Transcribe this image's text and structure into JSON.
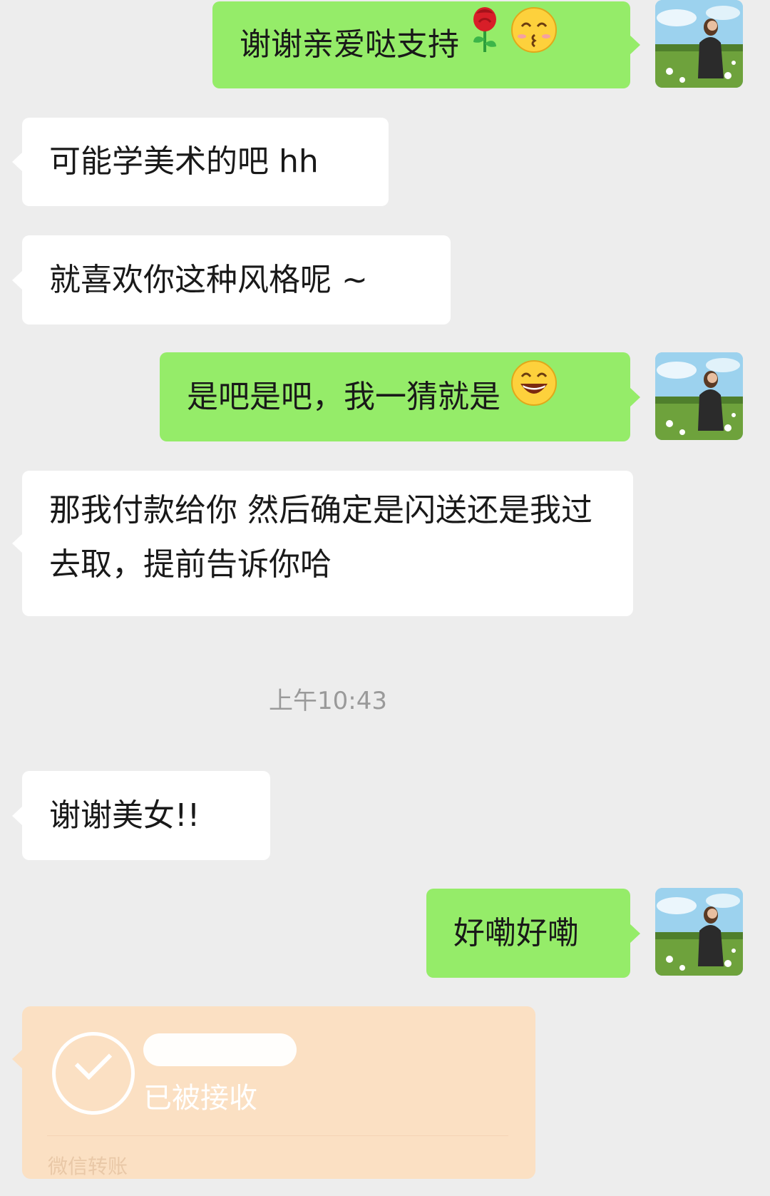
{
  "messages": [
    {
      "side": "out",
      "text": "谢谢亲爱哒支持",
      "emojis": [
        "rose-emoji",
        "kissing-face-emoji"
      ]
    },
    {
      "side": "in",
      "text": "可能学美术的吧 hh"
    },
    {
      "side": "in",
      "text": "就喜欢你这种风格呢 ~"
    },
    {
      "side": "out",
      "text": "是吧是吧，我一猜就是",
      "emojis": [
        "grinning-face-emoji"
      ]
    },
    {
      "side": "in",
      "text": "那我付款给你  然后确定是闪送还是我过去取，提前告诉你哈"
    },
    {
      "side": "in",
      "text": "谢谢美女!!"
    },
    {
      "side": "out",
      "text": "好嘞好嘞"
    }
  ],
  "timestamp": "上午10:43",
  "transfer": {
    "amount_hidden": true,
    "status": "已被接收",
    "footer": "微信转账",
    "color": "#fbe0c3"
  },
  "colors": {
    "background": "#ededed",
    "outgoing_bubble": "#95ec69",
    "incoming_bubble": "#ffffff"
  }
}
